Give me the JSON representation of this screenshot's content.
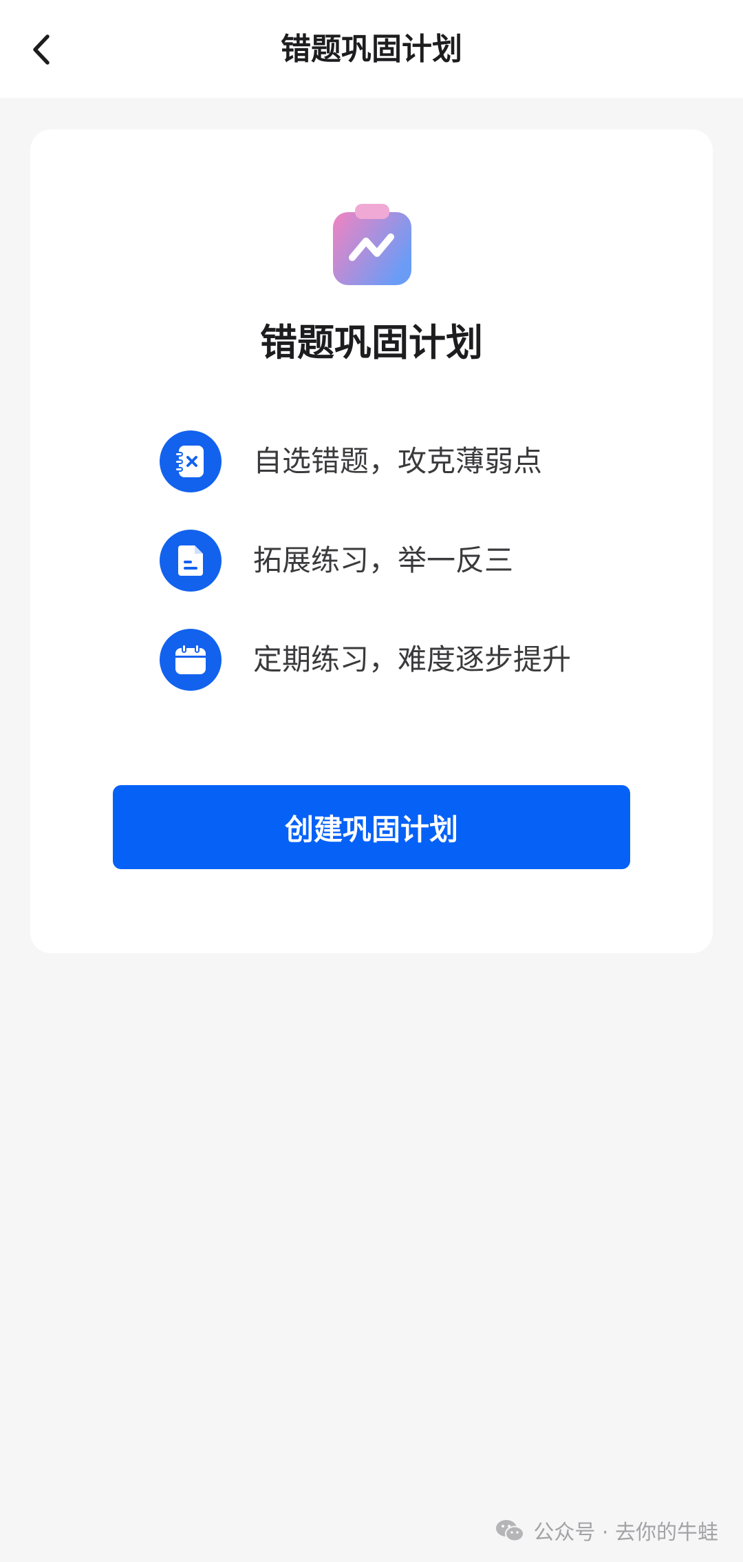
{
  "nav": {
    "title": "错题巩固计划"
  },
  "card": {
    "title": "错题巩固计划",
    "features": [
      {
        "icon": "notebook-x-icon",
        "text": "自选错题，攻克薄弱点"
      },
      {
        "icon": "document-icon",
        "text": "拓展练习，举一反三"
      },
      {
        "icon": "calendar-icon",
        "text": "定期练习，难度逐步提升"
      }
    ],
    "cta_label": "创建巩固计划"
  },
  "watermark": {
    "text": "公众号 · 去你的牛蛙"
  },
  "colors": {
    "primary": "#0661f7",
    "icon_circle": "#1262ee",
    "background": "#f6f6f7",
    "logo_gradient_start": "#f283c0",
    "logo_gradient_end": "#6a9cf6"
  }
}
